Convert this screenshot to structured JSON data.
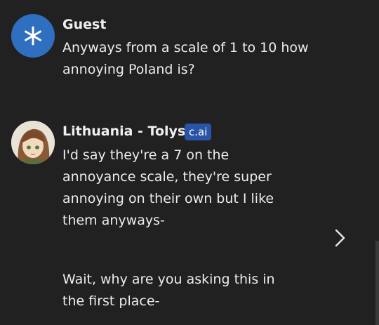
{
  "messages": [
    {
      "sender": "Guest",
      "avatar_icon": "asterisk-icon",
      "lines": [
        "Anyways from a scale of 1 to 10 how",
        "annoying Poland is?"
      ]
    },
    {
      "sender": "Lithuania - Tolys",
      "badge": "c.ai",
      "avatar_icon": "character-portrait",
      "paragraphs": [
        [
          "I'd say they're a 7 on the",
          "annoyance scale, they're super",
          "annoying on their own but I like",
          "them anyways-"
        ],
        [
          "Wait, why are you asking this in",
          "the first place-"
        ]
      ]
    }
  ],
  "controls": {
    "next_icon": "chevron-right-icon"
  },
  "colors": {
    "background": "#212121",
    "text": "#ececec",
    "guest_avatar": "#2f6fc0",
    "badge": "#2a54a6"
  }
}
